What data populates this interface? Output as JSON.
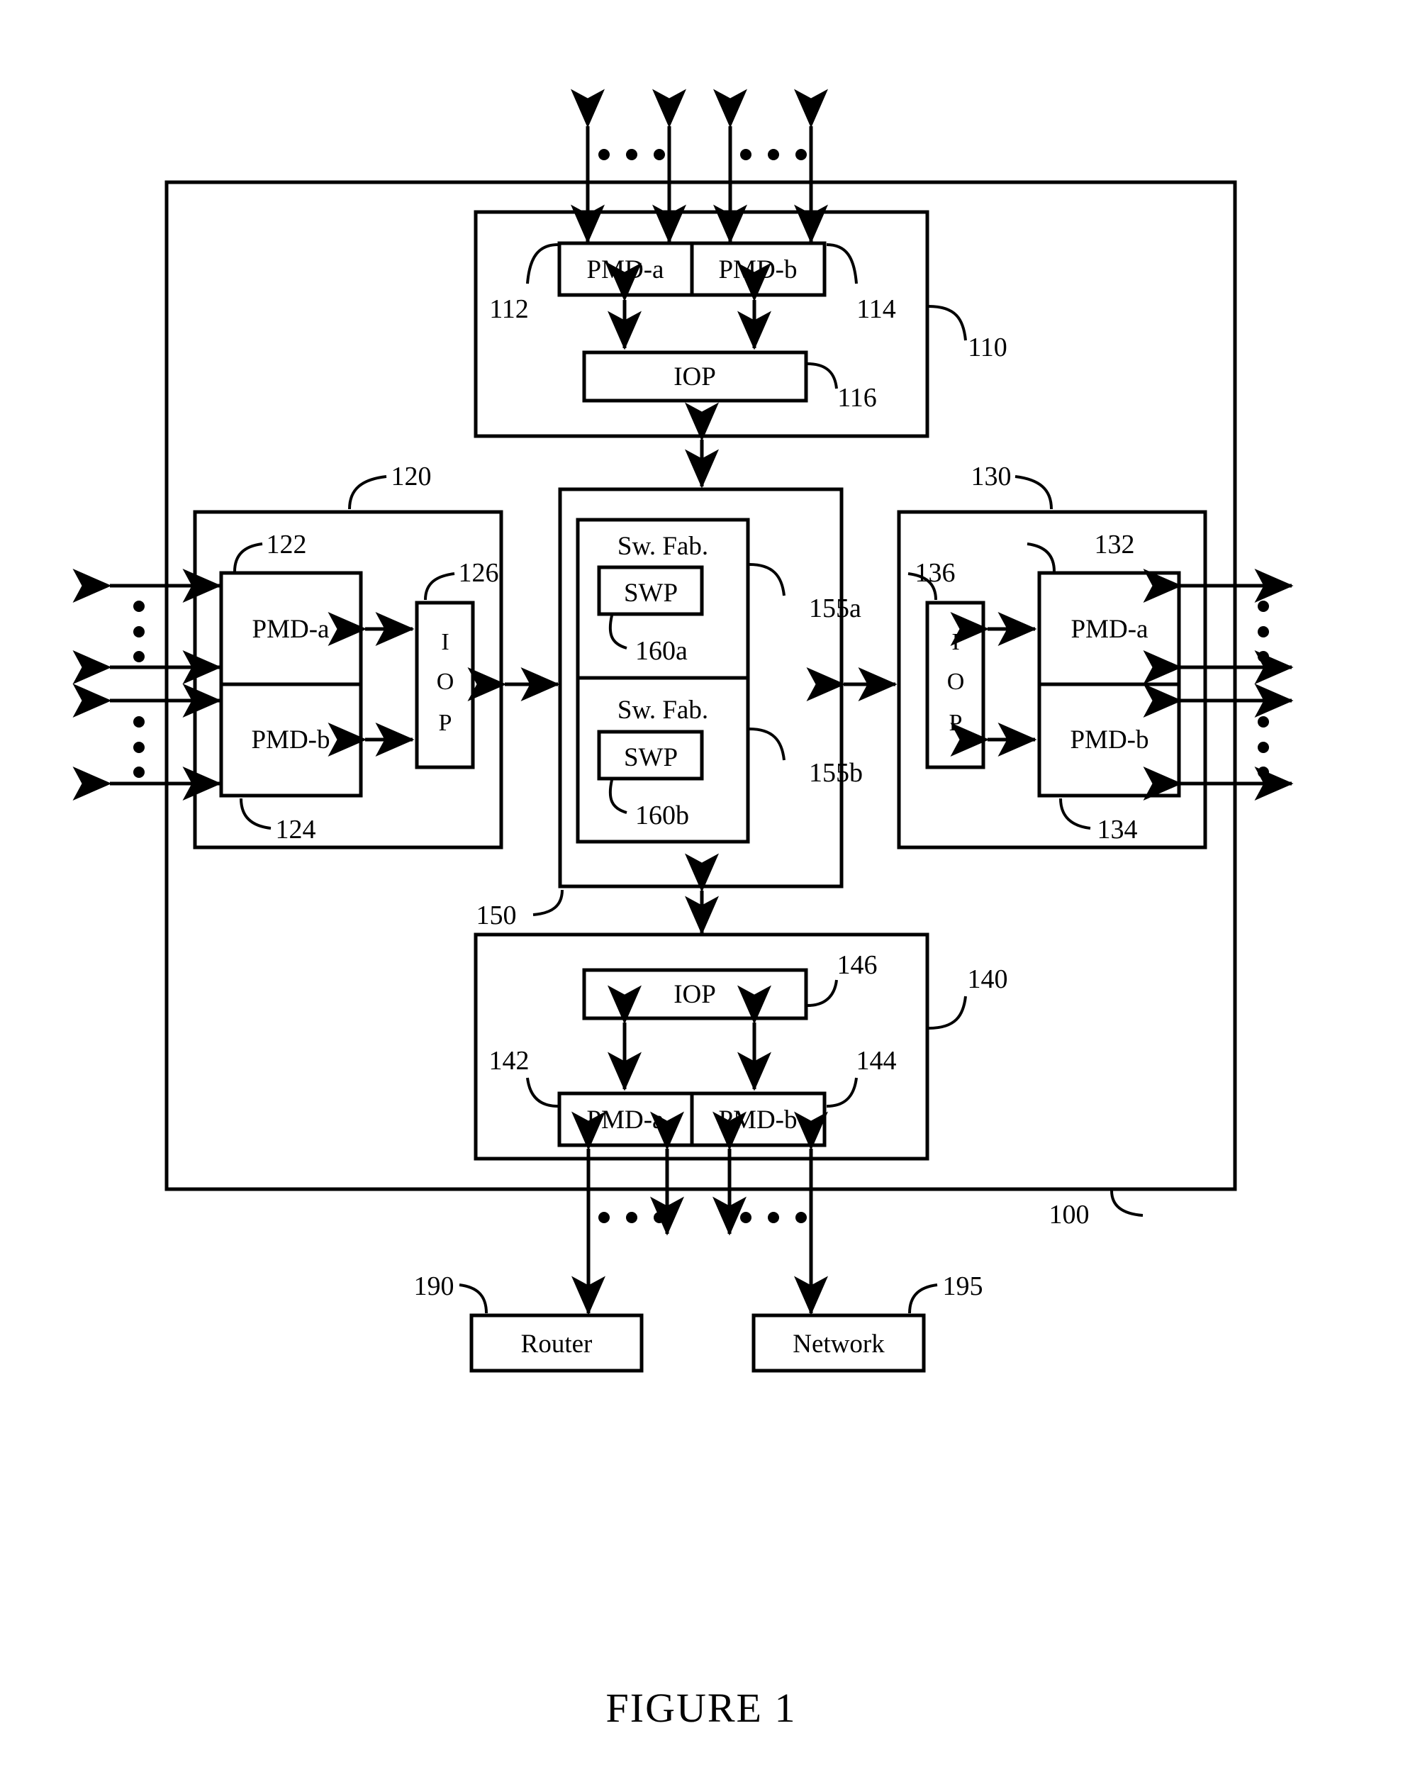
{
  "figure": {
    "caption": "FIGURE 1",
    "outer_ref": "100"
  },
  "blocks": {
    "top": {
      "ref": "110",
      "pmd_a": {
        "label": "PMD-a",
        "ref": "112"
      },
      "pmd_b": {
        "label": "PMD-b",
        "ref": "114"
      },
      "iop": {
        "label": "IOP",
        "ref": "116"
      }
    },
    "left": {
      "ref": "120",
      "pmd_a": {
        "label": "PMD-a",
        "ref": "122"
      },
      "pmd_b": {
        "label": "PMD-b",
        "ref": "124"
      },
      "iop": {
        "label": "IOP",
        "letters": [
          "I",
          "O",
          "P"
        ],
        "ref": "126"
      }
    },
    "right": {
      "ref": "130",
      "pmd_a": {
        "label": "PMD-a",
        "ref": "132"
      },
      "pmd_b": {
        "label": "PMD-b",
        "ref": "134"
      },
      "iop": {
        "label": "IOP",
        "letters": [
          "I",
          "O",
          "P"
        ],
        "ref": "136"
      }
    },
    "bottom": {
      "ref": "140",
      "pmd_a": {
        "label": "PMD-a",
        "ref": "142"
      },
      "pmd_b": {
        "label": "PMD-b",
        "ref": "144"
      },
      "iop": {
        "label": "IOP",
        "ref": "146"
      }
    },
    "center": {
      "ref": "150",
      "fabric_a": {
        "label": "Sw. Fab.",
        "ref": "155a",
        "swp": {
          "label": "SWP",
          "ref": "160a"
        }
      },
      "fabric_b": {
        "label": "Sw. Fab.",
        "ref": "155b",
        "swp": {
          "label": "SWP",
          "ref": "160b"
        }
      }
    }
  },
  "external": {
    "router": {
      "label": "Router",
      "ref": "190"
    },
    "network": {
      "label": "Network",
      "ref": "195"
    }
  },
  "style": {
    "line_color": "#000000",
    "background": "#ffffff"
  }
}
